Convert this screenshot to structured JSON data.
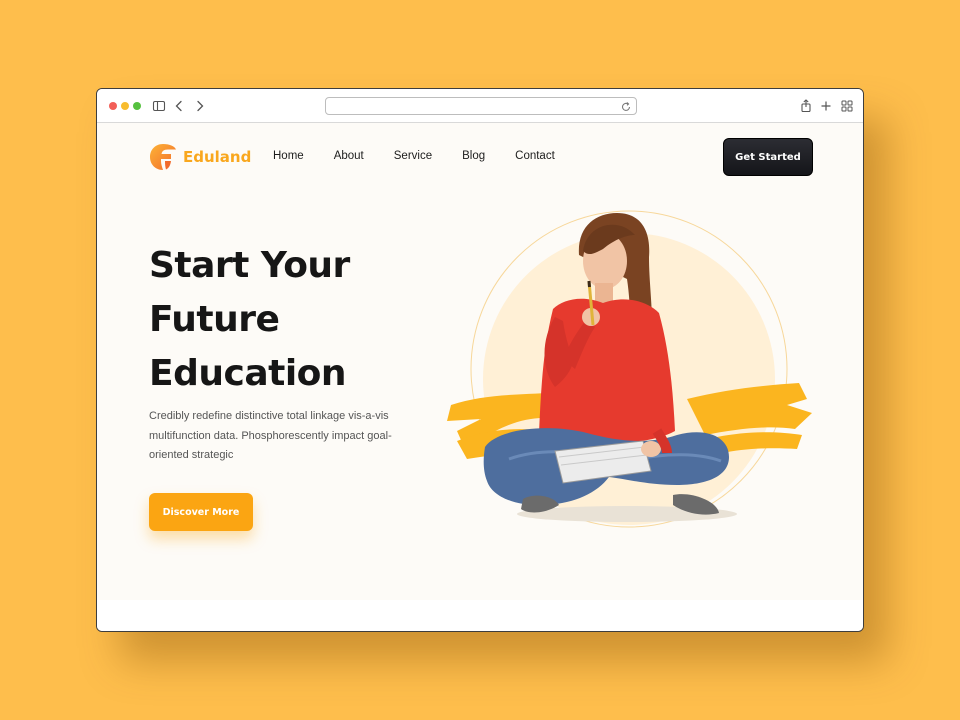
{
  "browser": {
    "address": "",
    "icons": [
      "sidebar-icon",
      "back-icon",
      "forward-icon",
      "reload-icon",
      "share-icon",
      "new-tab-icon",
      "tab-overview-icon"
    ]
  },
  "site": {
    "brand": "Eduland",
    "nav": [
      "Home",
      "About",
      "Service",
      "Blog",
      "Contact"
    ],
    "cta": "Get Started"
  },
  "hero": {
    "title_lines": [
      "Start Your",
      "Future",
      "Education"
    ],
    "description": "Credibly redefine distinctive total linkage vis-a-vis multifunction data. Phosphorescently impact goal-oriented strategic",
    "button": "Discover More"
  },
  "colors": {
    "page_background": "#FEBE4C",
    "brand_orange": "#F9A71D",
    "button_orange": "#FBA512",
    "dark_button": "#1c1d22",
    "hero_background": "#FDFBF7",
    "heading": "#161616"
  }
}
